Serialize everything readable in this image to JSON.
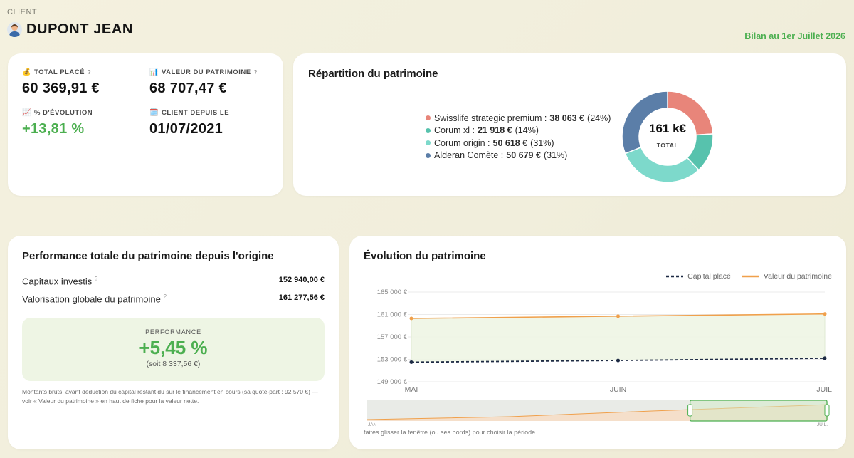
{
  "header": {
    "client_label": "CLIENT",
    "client_name": "DUPONT JEAN",
    "report_date": "Bilan au 1er Juillet 2026"
  },
  "kpis": {
    "total_label": "TOTAL PLACÉ",
    "total_value": "60 369,91 €",
    "patrimoine_label": "VALEUR DU PATRIMOINE",
    "patrimoine_value": "68 707,47 €",
    "evolution_label": "% D'ÉVOLUTION",
    "evolution_value": "+13,81 %",
    "since_label": "CLIENT DEPUIS LE",
    "since_value": "01/07/2021",
    "help_mark": "?",
    "icons": [
      "money-bag-icon",
      "bar-chart-icon",
      "trend-chart-icon",
      "calendar-icon"
    ]
  },
  "repartition": {
    "title": "Répartition du patrimoine",
    "items": [
      {
        "name": "Swisslife strategic premium :",
        "amount": "38 063 €",
        "pct": "(24%)",
        "color": "#e8857a"
      },
      {
        "name": "Corum xl :",
        "amount": "21 918 €",
        "pct": "(14%)",
        "color": "#57c2ad"
      },
      {
        "name": "Corum origin :",
        "amount": "50 618 €",
        "pct": "(31%)",
        "color": "#7dd9cb"
      },
      {
        "name": "Alderan Comète :",
        "amount": "50 679 €",
        "pct": "(31%)",
        "color": "#5b7ea8"
      }
    ],
    "shares": [
      24,
      14,
      31,
      31
    ],
    "total_value": "161 k€",
    "total_label": "TOTAL"
  },
  "performance": {
    "title": "Performance totale du patrimoine depuis l'origine",
    "capitaux_label": "Capitaux investis",
    "capitaux_value": "152 940,00 €",
    "valorisation_label": "Valorisation globale du patrimoine",
    "valorisation_value": "161 277,56 €",
    "box_title": "PERFORMANCE",
    "box_value": "+5,45 %",
    "box_sub": "(soit 8 337,56 €)",
    "note": "Montants bruts, avant déduction du capital restant dû sur le financement en cours (sa quote-part : 92 570 €) — voir « Valeur du patrimoine » en haut de fiche pour la valeur nette."
  },
  "evolution": {
    "title": "Évolution du patrimoine",
    "hint": "faites glisser la fenêtre (ou ses bords) pour choisir la période"
  },
  "chart_data": {
    "type": "line",
    "x": [
      "MAI",
      "JUIN",
      "JUIL"
    ],
    "series": [
      {
        "name": "Capital placé",
        "values": [
          152500,
          152800,
          153200
        ],
        "color": "#1d2a44",
        "style": "dashed"
      },
      {
        "name": "Valeur du patrimoine",
        "values": [
          160300,
          160700,
          161100
        ],
        "color": "#f0a04b",
        "style": "solid"
      }
    ],
    "ylim": [
      149000,
      165000
    ],
    "yticks": [
      165000,
      161000,
      157000,
      153000,
      149000
    ],
    "ytick_labels": [
      "165 000 €",
      "161 000 €",
      "157 000 €",
      "153 000 €",
      "149 000 €"
    ],
    "legend": "top-right",
    "grid": true,
    "navigator": {
      "start_label": "JAN",
      "end_label": "JUIL.",
      "window": [
        0.7,
        1.0
      ]
    }
  },
  "colors": {
    "accent_green": "#4caf50",
    "area_fill": "#eef5e4"
  }
}
